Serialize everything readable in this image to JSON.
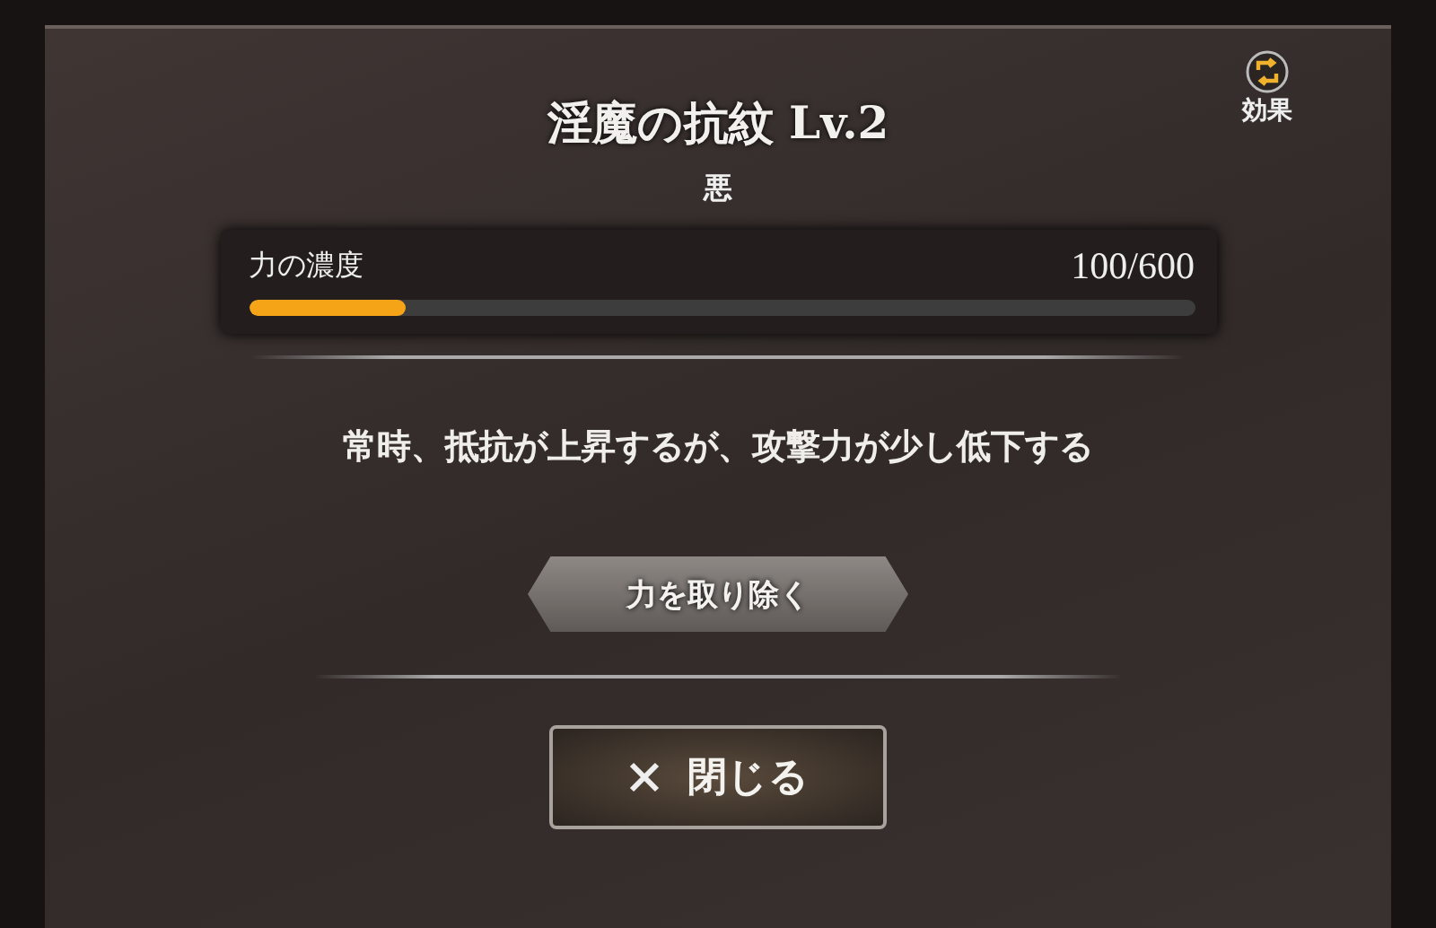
{
  "dialog": {
    "title": "淫魔の抗紋 Lv.2",
    "subtitle": "悪",
    "effect_button": {
      "label": "効果"
    },
    "gauge": {
      "label": "力の濃度",
      "reading": "100/600",
      "level": 0.1667
    },
    "description": "常時、抵抗が上昇するが、攻撃力が少し低下する",
    "remove_button": {
      "label": "力を取り除く"
    },
    "close_button": {
      "label": "閉じる"
    }
  }
}
